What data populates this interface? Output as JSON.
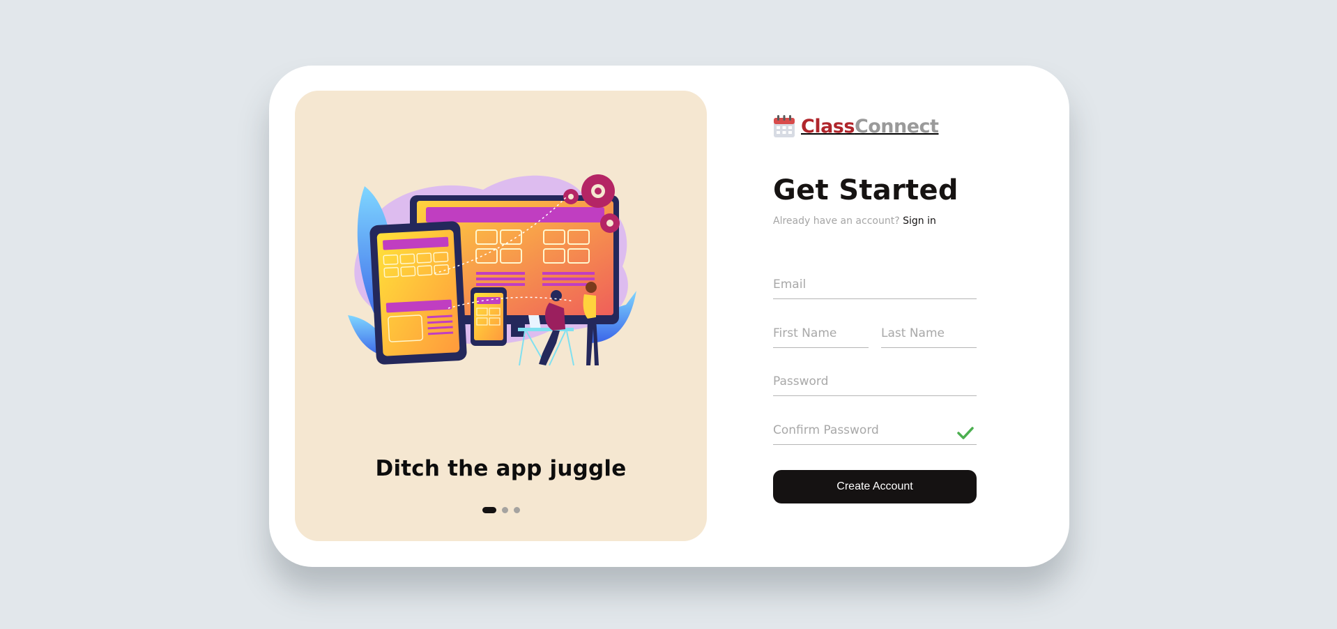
{
  "brand": {
    "name_part1": "Class",
    "name_part2": "Connect",
    "icon": "calendar-icon",
    "color_primary": "#b0262c",
    "color_secondary": "#9a9a9a"
  },
  "promo": {
    "slogan": "Ditch the app juggle",
    "illustration": "devices-collaboration-illustration",
    "carousel": {
      "count": 3,
      "active_index": 0
    }
  },
  "form": {
    "title": "Get Started",
    "subtitle_prefix": "Already have an account?",
    "signin_link": "Sign in",
    "email_placeholder": "Email",
    "first_name_placeholder": "First Name",
    "last_name_placeholder": "Last Name",
    "password_placeholder": "Password",
    "confirm_password_placeholder": "Confirm Password",
    "confirm_valid_icon": "checkmark-icon",
    "submit_label": "Create Account"
  },
  "colors": {
    "background": "#e2e7eb",
    "panel": "#f5e7d1",
    "button": "#151212",
    "success": "#4caf50"
  }
}
